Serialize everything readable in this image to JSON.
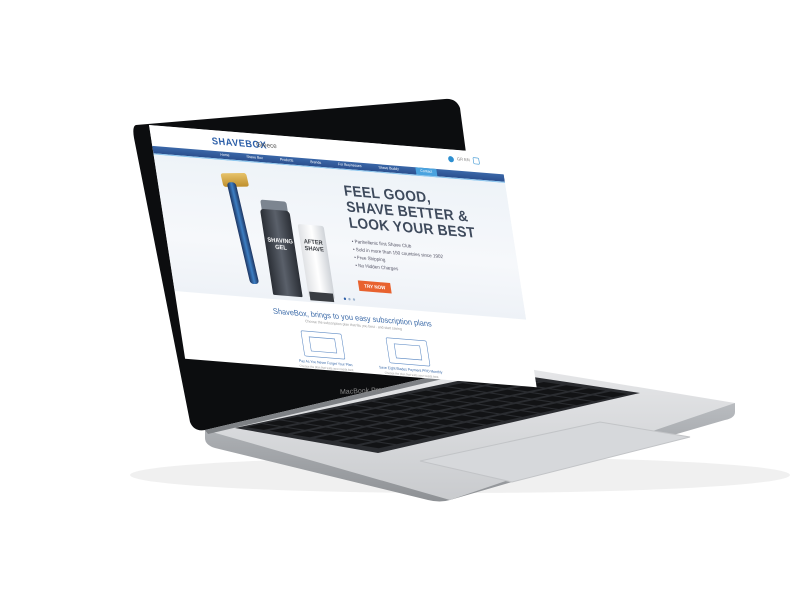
{
  "header": {
    "logo": "SHAVEBOX",
    "logo_tag": "Greece",
    "region": "GR EN"
  },
  "nav": {
    "items": [
      "Home",
      "Shave Box",
      "Products",
      "Brands",
      "For Businesses",
      "Shave Buddy",
      "Contact"
    ],
    "active_index": 6
  },
  "hero": {
    "title_lines": [
      "FEEL GOOD,",
      "SHAVE BETTER &",
      "LOOK YOUR BEST"
    ],
    "bullets": [
      "• Panhellenic first Shave Club",
      "• Sold in more than 150 countries since 1902",
      "• Free Shipping",
      "• No Hidden Charges"
    ],
    "cta": "TRY NOW",
    "slides": 3,
    "active_slide": 0,
    "gel_label": "SHAVING GEL",
    "aftershave_label": "AFTER SHAVE"
  },
  "plans": {
    "title": "ShaveBox, brings to you easy subscription plans",
    "subtitle": "Choose the subscription plan that fits you best - and start saving",
    "items": [
      {
        "name": "Pay As You Never Forget Your Plan",
        "desc": "Choose the plan that suits your needs best"
      },
      {
        "name": "Save Eight Blades Payment PRO Monthly",
        "desc": "Choose the plan that suits your needs best"
      }
    ]
  },
  "device": {
    "brand": "MacBook Pro"
  },
  "colors": {
    "brand": "#2b5ea8",
    "cta": "#e8622f",
    "nav": "#2b4f8e"
  }
}
